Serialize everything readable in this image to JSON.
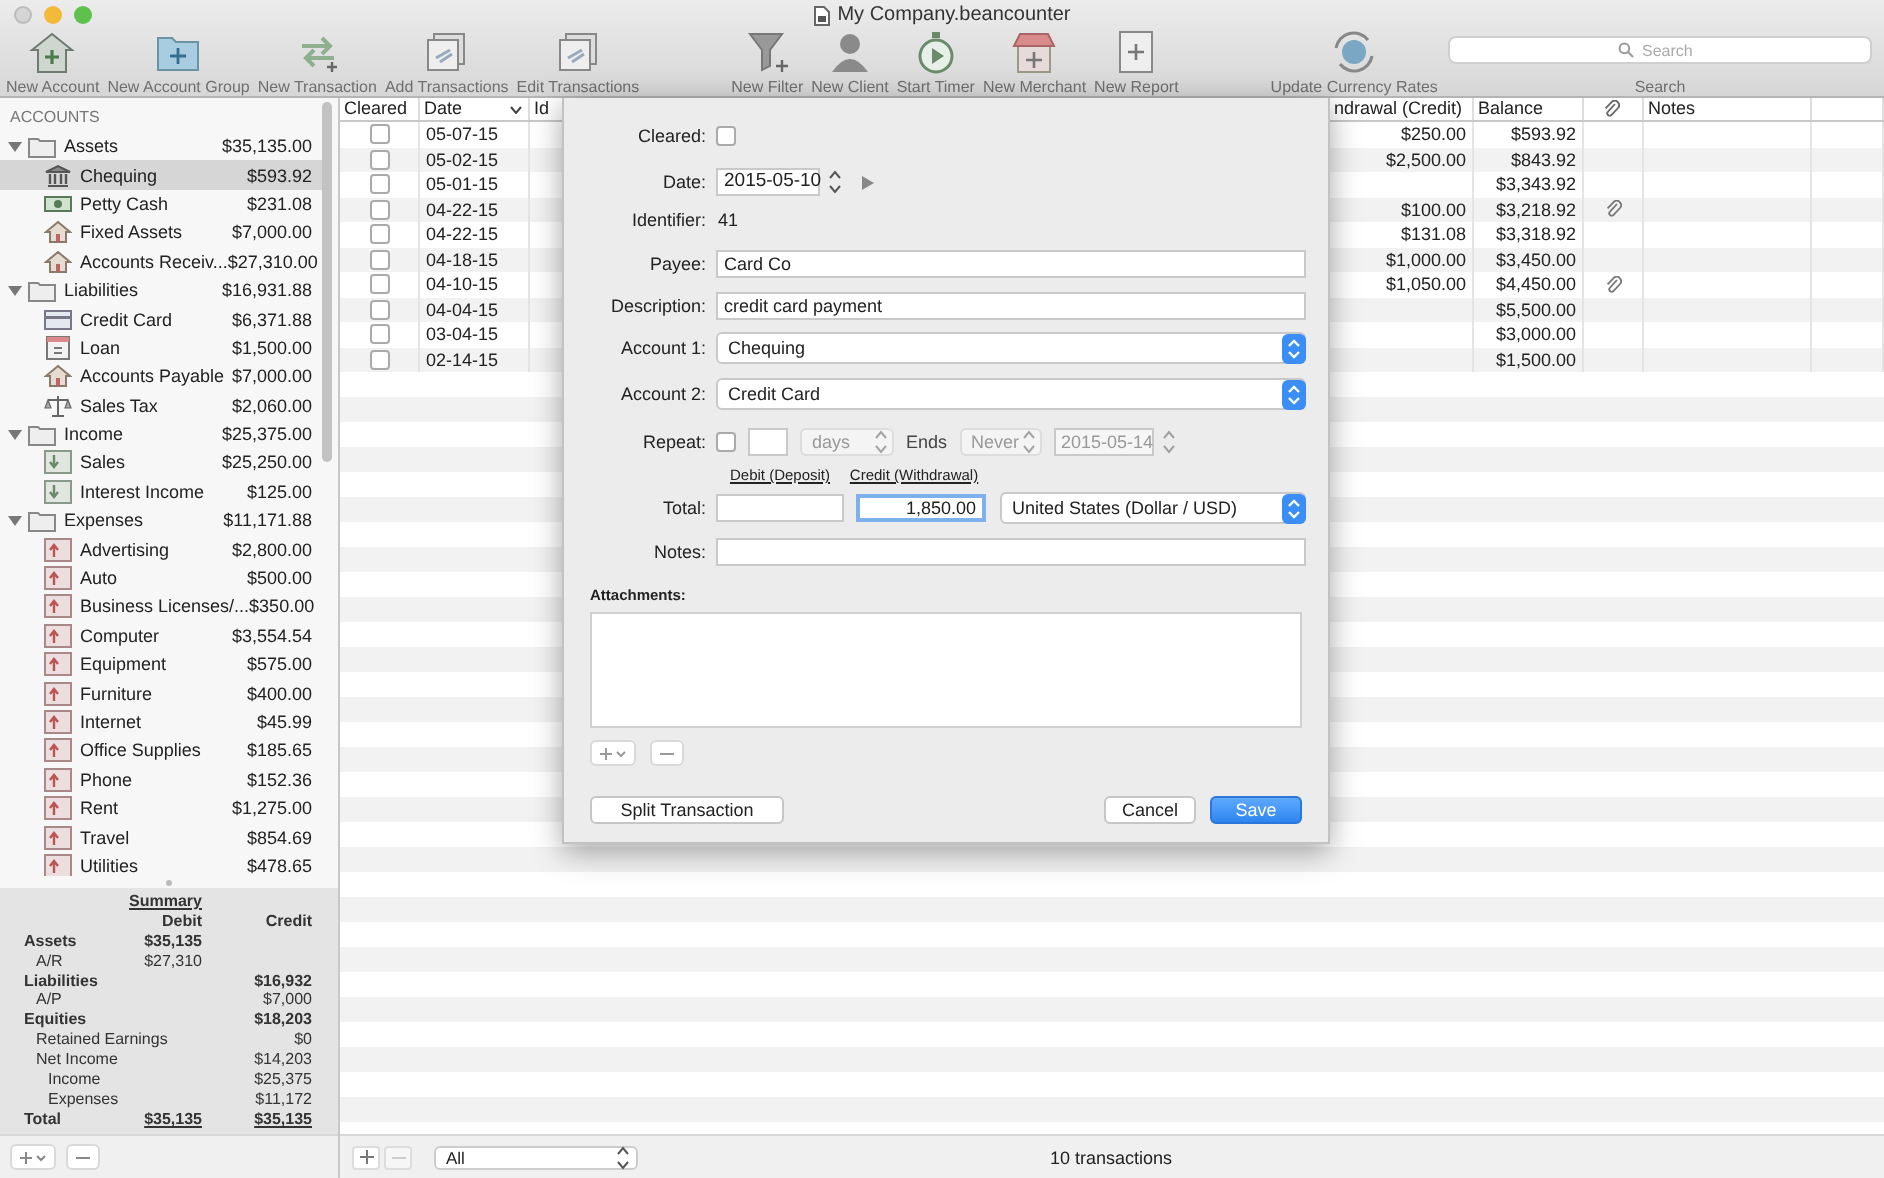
{
  "window": {
    "title": "My Company.beancounter"
  },
  "toolbar": {
    "groups": [
      [
        {
          "label": "New Account",
          "kind": "house"
        },
        {
          "label": "New Account Group",
          "kind": "folder"
        },
        {
          "label": "New Transaction",
          "kind": "arrows"
        },
        {
          "label": "Add Transactions",
          "kind": "stack"
        },
        {
          "label": "Edit Transactions",
          "kind": "stack"
        }
      ],
      [
        {
          "label": "New Filter",
          "kind": "filter"
        },
        {
          "label": "New Client",
          "kind": "person"
        },
        {
          "label": "Start Timer",
          "kind": "timer"
        },
        {
          "label": "New Merchant",
          "kind": "store"
        },
        {
          "label": "New Report",
          "kind": "report"
        }
      ],
      [
        {
          "label": "Update Currency Rates",
          "kind": "globe"
        }
      ]
    ],
    "search": {
      "placeholder": "Search",
      "label": "Search"
    }
  },
  "sidebar": {
    "heading": "ACCOUNTS",
    "groups": [
      {
        "name": "Assets",
        "amount": "$35,135.00",
        "expanded": true,
        "children": [
          {
            "name": "Chequing",
            "amount": "$593.92",
            "kind": "bank",
            "selected": true
          },
          {
            "name": "Petty Cash",
            "amount": "$231.08",
            "kind": "cash",
            "selected": false
          },
          {
            "name": "Fixed Assets",
            "amount": "$7,000.00",
            "kind": "house",
            "selected": false
          },
          {
            "name": "Accounts Receiv...",
            "amount": "$27,310.00",
            "kind": "house",
            "selected": false
          }
        ]
      },
      {
        "name": "Liabilities",
        "amount": "$16,931.88",
        "expanded": true,
        "children": [
          {
            "name": "Credit Card",
            "amount": "$6,371.88",
            "kind": "card",
            "selected": false
          },
          {
            "name": "Loan",
            "amount": "$1,500.00",
            "kind": "loan",
            "selected": false
          },
          {
            "name": "Accounts Payable",
            "amount": "$7,000.00",
            "kind": "house",
            "selected": false
          },
          {
            "name": "Sales Tax",
            "amount": "$2,060.00",
            "kind": "scale",
            "selected": false
          }
        ]
      },
      {
        "name": "Income",
        "amount": "$25,375.00",
        "expanded": true,
        "children": [
          {
            "name": "Sales",
            "amount": "$25,250.00",
            "kind": "income",
            "selected": false
          },
          {
            "name": "Interest Income",
            "amount": "$125.00",
            "kind": "income",
            "selected": false
          }
        ]
      },
      {
        "name": "Expenses",
        "amount": "$11,171.88",
        "expanded": true,
        "children": [
          {
            "name": "Advertising",
            "amount": "$2,800.00",
            "kind": "expense",
            "selected": false
          },
          {
            "name": "Auto",
            "amount": "$500.00",
            "kind": "expense",
            "selected": false
          },
          {
            "name": "Business Licenses/...",
            "amount": "$350.00",
            "kind": "expense",
            "selected": false
          },
          {
            "name": "Computer",
            "amount": "$3,554.54",
            "kind": "expense",
            "selected": false
          },
          {
            "name": "Equipment",
            "amount": "$575.00",
            "kind": "expense",
            "selected": false
          },
          {
            "name": "Furniture",
            "amount": "$400.00",
            "kind": "expense",
            "selected": false
          },
          {
            "name": "Internet",
            "amount": "$45.99",
            "kind": "expense",
            "selected": false
          },
          {
            "name": "Office Supplies",
            "amount": "$185.65",
            "kind": "expense",
            "selected": false
          },
          {
            "name": "Phone",
            "amount": "$152.36",
            "kind": "expense",
            "selected": false
          },
          {
            "name": "Rent",
            "amount": "$1,275.00",
            "kind": "expense",
            "selected": false
          },
          {
            "name": "Travel",
            "amount": "$854.69",
            "kind": "expense",
            "selected": false
          },
          {
            "name": "Utilities",
            "amount": "$478.65",
            "kind": "expense",
            "selected": false
          }
        ]
      }
    ]
  },
  "summary": {
    "title": "Summary",
    "debit_heading": "Debit",
    "credit_heading": "Credit",
    "rows": [
      {
        "label": "Assets",
        "debit": "$35,135",
        "children": [
          {
            "label": "A/R",
            "debit": "$27,310"
          }
        ]
      },
      {
        "label": "Liabilities",
        "credit": "$16,932",
        "children": [
          {
            "label": "A/P",
            "credit": "$7,000"
          }
        ]
      },
      {
        "label": "Equities",
        "credit": "$18,203",
        "children": [
          {
            "label": "Retained Earnings",
            "credit": "$0"
          },
          {
            "label": "Net Income",
            "credit": "$14,203",
            "children": [
              {
                "label": "Income",
                "credit": "$25,375"
              },
              {
                "label": "Expenses",
                "credit": "$11,172"
              }
            ]
          }
        ]
      },
      {
        "label": "Total",
        "kind": "total",
        "debit": "$35,135",
        "credit": "$35,135"
      }
    ]
  },
  "table": {
    "columns": {
      "cleared": "Cleared",
      "date": "Date",
      "id": "Id",
      "withdrawal": "ndrawal (Credit)",
      "balance": "Balance",
      "notes": "Notes"
    },
    "rows": [
      {
        "cleared": false,
        "date": "05-07-15",
        "withdrawal": "$250.00",
        "balance": "$593.92",
        "attachment": false
      },
      {
        "cleared": false,
        "date": "05-02-15",
        "withdrawal": "$2,500.00",
        "balance": "$843.92",
        "attachment": false
      },
      {
        "cleared": false,
        "date": "05-01-15",
        "balance": "$3,343.92",
        "attachment": false
      },
      {
        "cleared": false,
        "date": "04-22-15",
        "withdrawal": "$100.00",
        "balance": "$3,218.92",
        "attachment": true
      },
      {
        "cleared": false,
        "date": "04-22-15",
        "withdrawal": "$131.08",
        "balance": "$3,318.92",
        "attachment": false
      },
      {
        "cleared": false,
        "date": "04-18-15",
        "withdrawal": "$1,000.00",
        "balance": "$3,450.00",
        "attachment": false
      },
      {
        "cleared": false,
        "date": "04-10-15",
        "withdrawal": "$1,050.00",
        "balance": "$4,450.00",
        "attachment": true
      },
      {
        "cleared": false,
        "date": "04-04-15",
        "balance": "$5,500.00",
        "attachment": false
      },
      {
        "cleared": false,
        "date": "03-04-15",
        "balance": "$3,000.00",
        "attachment": false
      },
      {
        "cleared": false,
        "date": "02-14-15",
        "balance": "$1,500.00",
        "attachment": false
      }
    ]
  },
  "footer": {
    "filter": "All",
    "count": "10 transactions"
  },
  "dialog": {
    "cleared": {
      "label": "Cleared:",
      "checked": false
    },
    "date": {
      "label": "Date:",
      "value": "2015-05-10"
    },
    "identifier": {
      "label": "Identifier:",
      "value": "41"
    },
    "payee": {
      "label": "Payee:",
      "value": "Card Co"
    },
    "description": {
      "label": "Description:",
      "value": "credit card payment"
    },
    "account_1": {
      "label": "Account 1:",
      "value": "Chequing"
    },
    "account_2": {
      "label": "Account 2:",
      "value": "Credit Card"
    },
    "repeat": {
      "label": "Repeat:",
      "checked": false,
      "unit": "days",
      "ends_label": "Ends",
      "ends": "Never",
      "end_date": "2015-05-14",
      "disabled": true
    },
    "total": {
      "label": "Total:",
      "debit_label": "Debit (Deposit)",
      "credit_label": "Credit (Withdrawal)",
      "credit": "1,850.00",
      "credit_focused": true,
      "currency": "United States (Dollar / USD)"
    },
    "notes": {
      "label": "Notes:"
    },
    "attachments": {
      "label": "Attachments:"
    },
    "buttons": [
      {
        "label": "Split Transaction",
        "kind": "plain"
      },
      {
        "label": "Cancel",
        "kind": "plain"
      },
      {
        "label": "Save",
        "kind": "default"
      }
    ]
  }
}
